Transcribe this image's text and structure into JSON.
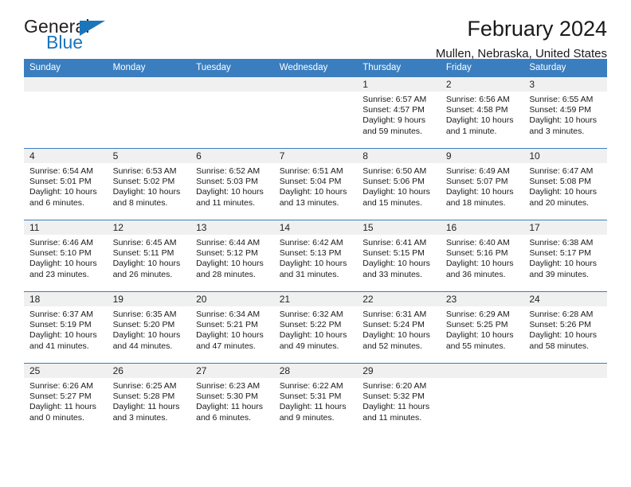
{
  "brand": {
    "name_part1": "General",
    "name_part2": "Blue",
    "accent_color": "#1b75bb"
  },
  "header": {
    "title": "February 2024",
    "location": "Mullen, Nebraska, United States"
  },
  "calendar": {
    "header_bg": "#3a7ebf",
    "daynum_bg": "#f0f0f0",
    "weekday_headers": [
      "Sunday",
      "Monday",
      "Tuesday",
      "Wednesday",
      "Thursday",
      "Friday",
      "Saturday"
    ],
    "labels": {
      "sunrise": "Sunrise:",
      "sunset": "Sunset:",
      "daylight": "Daylight:"
    },
    "weeks": [
      [
        {
          "day": ""
        },
        {
          "day": ""
        },
        {
          "day": ""
        },
        {
          "day": ""
        },
        {
          "day": "1",
          "sunrise": "Sunrise: 6:57 AM",
          "sunset": "Sunset: 4:57 PM",
          "daylight": "Daylight: 9 hours and 59 minutes."
        },
        {
          "day": "2",
          "sunrise": "Sunrise: 6:56 AM",
          "sunset": "Sunset: 4:58 PM",
          "daylight": "Daylight: 10 hours and 1 minute."
        },
        {
          "day": "3",
          "sunrise": "Sunrise: 6:55 AM",
          "sunset": "Sunset: 4:59 PM",
          "daylight": "Daylight: 10 hours and 3 minutes."
        }
      ],
      [
        {
          "day": "4",
          "sunrise": "Sunrise: 6:54 AM",
          "sunset": "Sunset: 5:01 PM",
          "daylight": "Daylight: 10 hours and 6 minutes."
        },
        {
          "day": "5",
          "sunrise": "Sunrise: 6:53 AM",
          "sunset": "Sunset: 5:02 PM",
          "daylight": "Daylight: 10 hours and 8 minutes."
        },
        {
          "day": "6",
          "sunrise": "Sunrise: 6:52 AM",
          "sunset": "Sunset: 5:03 PM",
          "daylight": "Daylight: 10 hours and 11 minutes."
        },
        {
          "day": "7",
          "sunrise": "Sunrise: 6:51 AM",
          "sunset": "Sunset: 5:04 PM",
          "daylight": "Daylight: 10 hours and 13 minutes."
        },
        {
          "day": "8",
          "sunrise": "Sunrise: 6:50 AM",
          "sunset": "Sunset: 5:06 PM",
          "daylight": "Daylight: 10 hours and 15 minutes."
        },
        {
          "day": "9",
          "sunrise": "Sunrise: 6:49 AM",
          "sunset": "Sunset: 5:07 PM",
          "daylight": "Daylight: 10 hours and 18 minutes."
        },
        {
          "day": "10",
          "sunrise": "Sunrise: 6:47 AM",
          "sunset": "Sunset: 5:08 PM",
          "daylight": "Daylight: 10 hours and 20 minutes."
        }
      ],
      [
        {
          "day": "11",
          "sunrise": "Sunrise: 6:46 AM",
          "sunset": "Sunset: 5:10 PM",
          "daylight": "Daylight: 10 hours and 23 minutes."
        },
        {
          "day": "12",
          "sunrise": "Sunrise: 6:45 AM",
          "sunset": "Sunset: 5:11 PM",
          "daylight": "Daylight: 10 hours and 26 minutes."
        },
        {
          "day": "13",
          "sunrise": "Sunrise: 6:44 AM",
          "sunset": "Sunset: 5:12 PM",
          "daylight": "Daylight: 10 hours and 28 minutes."
        },
        {
          "day": "14",
          "sunrise": "Sunrise: 6:42 AM",
          "sunset": "Sunset: 5:13 PM",
          "daylight": "Daylight: 10 hours and 31 minutes."
        },
        {
          "day": "15",
          "sunrise": "Sunrise: 6:41 AM",
          "sunset": "Sunset: 5:15 PM",
          "daylight": "Daylight: 10 hours and 33 minutes."
        },
        {
          "day": "16",
          "sunrise": "Sunrise: 6:40 AM",
          "sunset": "Sunset: 5:16 PM",
          "daylight": "Daylight: 10 hours and 36 minutes."
        },
        {
          "day": "17",
          "sunrise": "Sunrise: 6:38 AM",
          "sunset": "Sunset: 5:17 PM",
          "daylight": "Daylight: 10 hours and 39 minutes."
        }
      ],
      [
        {
          "day": "18",
          "sunrise": "Sunrise: 6:37 AM",
          "sunset": "Sunset: 5:19 PM",
          "daylight": "Daylight: 10 hours and 41 minutes."
        },
        {
          "day": "19",
          "sunrise": "Sunrise: 6:35 AM",
          "sunset": "Sunset: 5:20 PM",
          "daylight": "Daylight: 10 hours and 44 minutes."
        },
        {
          "day": "20",
          "sunrise": "Sunrise: 6:34 AM",
          "sunset": "Sunset: 5:21 PM",
          "daylight": "Daylight: 10 hours and 47 minutes."
        },
        {
          "day": "21",
          "sunrise": "Sunrise: 6:32 AM",
          "sunset": "Sunset: 5:22 PM",
          "daylight": "Daylight: 10 hours and 49 minutes."
        },
        {
          "day": "22",
          "sunrise": "Sunrise: 6:31 AM",
          "sunset": "Sunset: 5:24 PM",
          "daylight": "Daylight: 10 hours and 52 minutes."
        },
        {
          "day": "23",
          "sunrise": "Sunrise: 6:29 AM",
          "sunset": "Sunset: 5:25 PM",
          "daylight": "Daylight: 10 hours and 55 minutes."
        },
        {
          "day": "24",
          "sunrise": "Sunrise: 6:28 AM",
          "sunset": "Sunset: 5:26 PM",
          "daylight": "Daylight: 10 hours and 58 minutes."
        }
      ],
      [
        {
          "day": "25",
          "sunrise": "Sunrise: 6:26 AM",
          "sunset": "Sunset: 5:27 PM",
          "daylight": "Daylight: 11 hours and 0 minutes."
        },
        {
          "day": "26",
          "sunrise": "Sunrise: 6:25 AM",
          "sunset": "Sunset: 5:28 PM",
          "daylight": "Daylight: 11 hours and 3 minutes."
        },
        {
          "day": "27",
          "sunrise": "Sunrise: 6:23 AM",
          "sunset": "Sunset: 5:30 PM",
          "daylight": "Daylight: 11 hours and 6 minutes."
        },
        {
          "day": "28",
          "sunrise": "Sunrise: 6:22 AM",
          "sunset": "Sunset: 5:31 PM",
          "daylight": "Daylight: 11 hours and 9 minutes."
        },
        {
          "day": "29",
          "sunrise": "Sunrise: 6:20 AM",
          "sunset": "Sunset: 5:32 PM",
          "daylight": "Daylight: 11 hours and 11 minutes."
        },
        {
          "day": ""
        },
        {
          "day": ""
        }
      ]
    ]
  }
}
